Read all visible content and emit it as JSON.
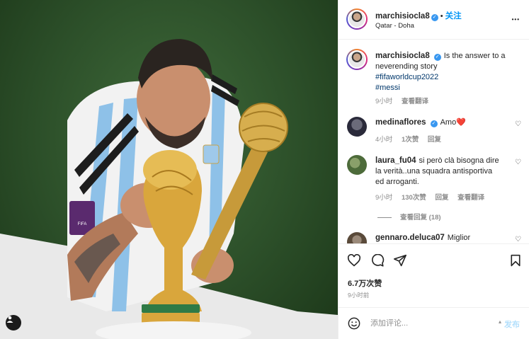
{
  "post": {
    "author": "marchisiocla8",
    "follow_label": "关注",
    "dot": "•",
    "location": "Qatar - Doha",
    "more_label": "•••",
    "caption": "Is the answer to a neverending story",
    "hashtags": [
      "#fifaworldcup2022",
      "#messi"
    ],
    "caption_time": "9小时",
    "caption_translate": "查看翻译"
  },
  "comments": [
    {
      "username": "medinaflores",
      "verified": true,
      "text": "Amo",
      "emoji": "❤️",
      "time": "4小时",
      "likes": "1次赞",
      "reply": "回复"
    },
    {
      "username": "laura_fu04",
      "verified": false,
      "text": "si però clà bisogna dire la verità..una squadra antisportiva ed arroganti.",
      "time": "9小时",
      "likes": "130次赞",
      "reply": "回复",
      "translate": "查看翻译",
      "view_replies": "查看回复 (18)"
    },
    {
      "username": "gennaro.deluca07",
      "verified": false,
      "text": "Miglior"
    }
  ],
  "stats": {
    "likes": "6.7万次赞",
    "time": "9小时前"
  },
  "add_comment": {
    "placeholder": "添加评论...",
    "post_label": "发布"
  },
  "colors": {
    "accent": "#0095f6",
    "verified": "#3897f0",
    "post_disabled": "#b2dffc",
    "muted": "#8e8e8e",
    "hashtag": "#00376b"
  }
}
